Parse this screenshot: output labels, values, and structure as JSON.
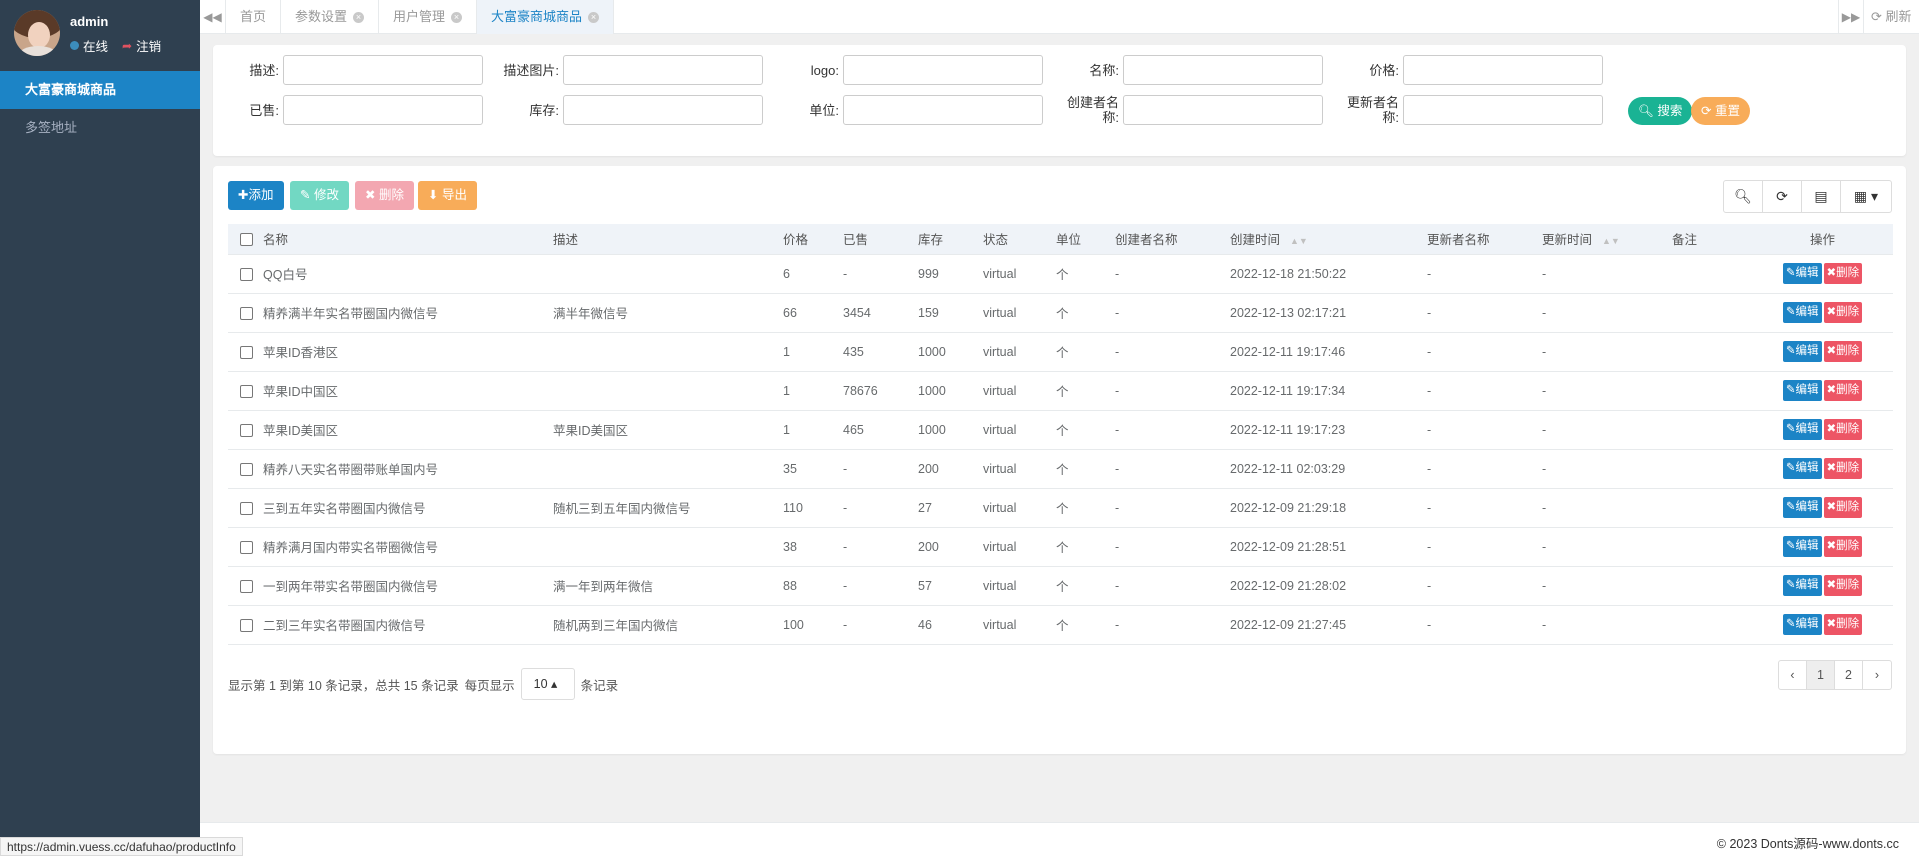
{
  "user": {
    "name": "admin",
    "status": "在线",
    "logout": "注销"
  },
  "sidebar": {
    "items": [
      {
        "label": "大富豪商城商品",
        "active": true
      },
      {
        "label": "多签地址",
        "active": false
      }
    ]
  },
  "tabs": {
    "items": [
      "首页",
      "参数设置",
      "用户管理",
      "大富豪商城商品"
    ],
    "refresh": "刷新"
  },
  "search": {
    "fields": [
      "描述:",
      "描述图片:",
      "logo:",
      "名称:",
      "价格:",
      "已售:",
      "库存:",
      "单位:",
      "创建者名称:",
      "更新者名称:"
    ],
    "search_label": "搜索",
    "reset_label": "重置"
  },
  "toolbar": {
    "add": "添加",
    "edit": "修改",
    "delete": "删除",
    "export": "导出"
  },
  "table": {
    "headers": [
      "名称",
      "描述",
      "价格",
      "已售",
      "库存",
      "状态",
      "单位",
      "创建者名称",
      "创建时间",
      "更新者名称",
      "更新时间",
      "备注",
      "操作"
    ],
    "edit_label": "编辑",
    "delete_label": "删除",
    "rows": [
      [
        "QQ白号",
        "",
        "6",
        "-",
        "999",
        "virtual",
        "个",
        "-",
        "2022-12-18 21:50:22",
        "-",
        "-",
        ""
      ],
      [
        "精养满半年实名带圈国内微信号",
        "满半年微信号",
        "66",
        "3454",
        "159",
        "virtual",
        "个",
        "-",
        "2022-12-13 02:17:21",
        "-",
        "-",
        ""
      ],
      [
        "苹果ID香港区",
        "",
        "1",
        "435",
        "1000",
        "virtual",
        "个",
        "-",
        "2022-12-11 19:17:46",
        "-",
        "-",
        ""
      ],
      [
        "苹果ID中国区",
        "",
        "1",
        "78676",
        "1000",
        "virtual",
        "个",
        "-",
        "2022-12-11 19:17:34",
        "-",
        "-",
        ""
      ],
      [
        "苹果ID美国区",
        "苹果ID美国区",
        "1",
        "465",
        "1000",
        "virtual",
        "个",
        "-",
        "2022-12-11 19:17:23",
        "-",
        "-",
        ""
      ],
      [
        "精养八天实名带圈带账单国内号",
        "",
        "35",
        "-",
        "200",
        "virtual",
        "个",
        "-",
        "2022-12-11 02:03:29",
        "-",
        "-",
        ""
      ],
      [
        "三到五年实名带圈国内微信号",
        "随机三到五年国内微信号",
        "110",
        "-",
        "27",
        "virtual",
        "个",
        "-",
        "2022-12-09 21:29:18",
        "-",
        "-",
        ""
      ],
      [
        "精养满月国内带实名带圈微信号",
        "",
        "38",
        "-",
        "200",
        "virtual",
        "个",
        "-",
        "2022-12-09 21:28:51",
        "-",
        "-",
        ""
      ],
      [
        "一到两年带实名带圈国内微信号",
        "满一年到两年微信",
        "88",
        "-",
        "57",
        "virtual",
        "个",
        "-",
        "2022-12-09 21:28:02",
        "-",
        "-",
        ""
      ],
      [
        "二到三年实名带圈国内微信号",
        "随机两到三年国内微信",
        "100",
        "-",
        "46",
        "virtual",
        "个",
        "-",
        "2022-12-09 21:27:45",
        "-",
        "-",
        ""
      ]
    ]
  },
  "pagination": {
    "info": "显示第 1 到第 10 条记录，总共 15 条记录",
    "per_page_label": "每页显示",
    "page_size": "10",
    "suffix": "条记录",
    "pages": [
      "‹",
      "1",
      "2",
      "›"
    ]
  },
  "footer": {
    "copyright": "© 2023 Donts源码-www.donts.cc"
  },
  "statusbar": {
    "url": "https://admin.vuess.cc/dafuhao/productInfo"
  }
}
